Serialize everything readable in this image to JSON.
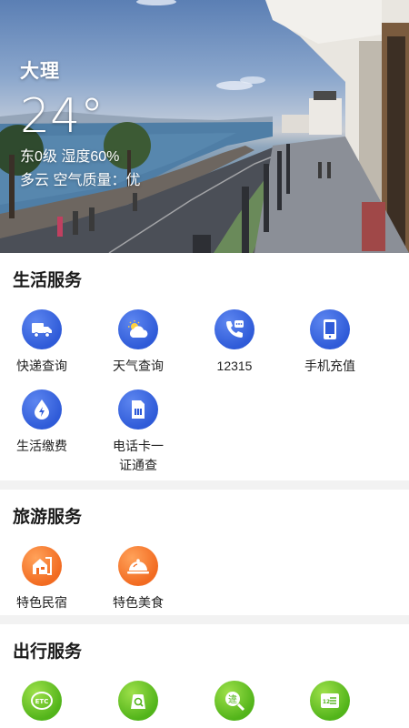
{
  "weather": {
    "city": "大理",
    "temperature": "24°",
    "wind_humidity": "东0级 湿度60%",
    "condition_aqi": "多云 空气质量：优"
  },
  "sections": {
    "life": {
      "title": "生活服务",
      "items": [
        {
          "label": "快递查询",
          "icon": "truck-icon"
        },
        {
          "label": "天气查询",
          "icon": "weather-cloud-sun-icon"
        },
        {
          "label": "12315",
          "icon": "phone-chat-icon"
        },
        {
          "label": "手机充值",
          "icon": "mobile-phone-icon"
        },
        {
          "label": "生活缴费",
          "icon": "water-drop-bolt-icon"
        },
        {
          "label": "电话卡一\n证通查",
          "icon": "sim-card-icon"
        }
      ]
    },
    "travel": {
      "title": "旅游服务",
      "items": [
        {
          "label": "特色民宿",
          "icon": "homestay-house-icon"
        },
        {
          "label": "特色美食",
          "icon": "food-cloche-icon"
        }
      ]
    },
    "trip": {
      "title": "出行服务",
      "items": [
        {
          "label": "",
          "icon": "etc-icon"
        },
        {
          "label": "",
          "icon": "vehicle-search-icon"
        },
        {
          "label": "",
          "icon": "violation-search-icon"
        },
        {
          "label": "",
          "icon": "license-plate-icon"
        }
      ]
    }
  },
  "colors": {
    "life_icon": "#2f5bd8",
    "travel_icon": "#f26b21",
    "trip_icon": "#52b41a",
    "divider": "#f2f2f2"
  }
}
